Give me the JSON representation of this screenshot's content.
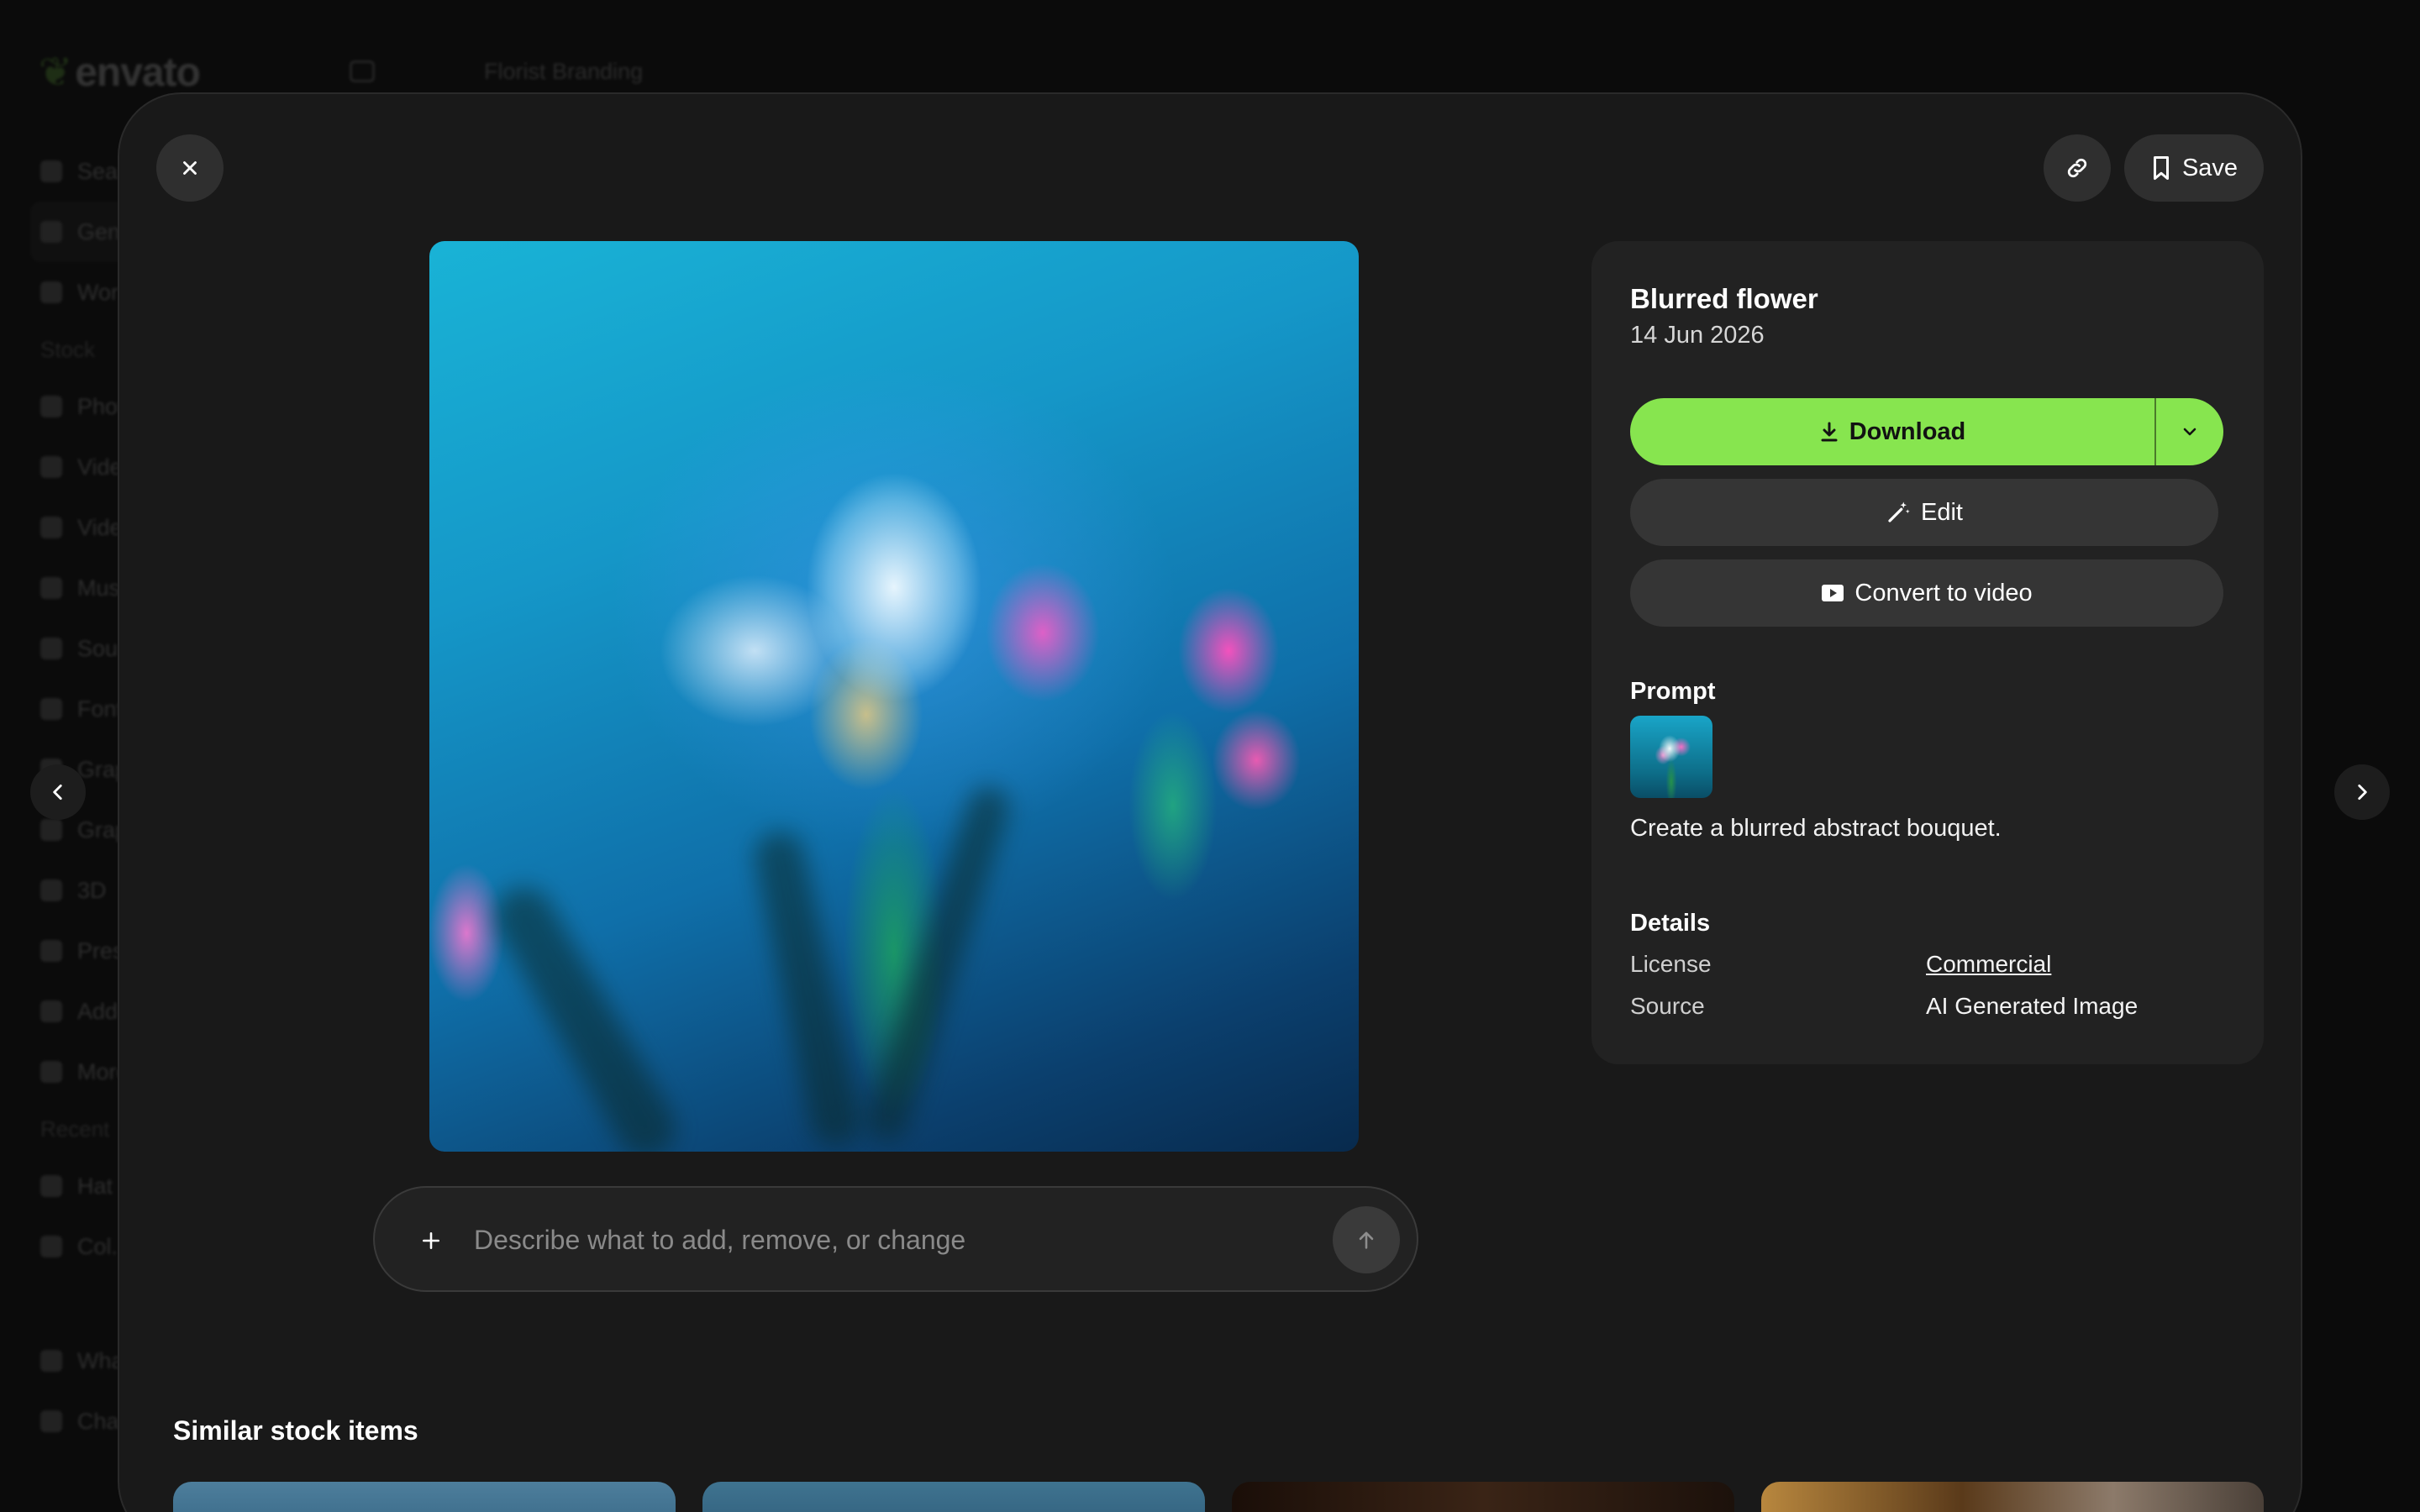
{
  "background_app": {
    "logo": "envato",
    "project_name": "Florist Branding",
    "sidebar_items": [
      "Search",
      "Generate",
      "Workspaces"
    ],
    "section_stock": "Stock",
    "stock_items": [
      "Photos",
      "Video",
      "Video templates",
      "Music",
      "Sound effects",
      "Fonts",
      "Graphics",
      "Graphic templates",
      "3D",
      "Presentation templates",
      "Add-ons",
      "More"
    ],
    "section_recent": "Recent",
    "recent_items": [
      "Hat",
      "Col..."
    ],
    "footer_items": [
      "What's new",
      "Changelog"
    ]
  },
  "modal": {
    "save_label": "Save",
    "icons": {
      "close": "close-icon",
      "link": "link-icon",
      "bookmark": "bookmark-icon",
      "prev": "chevron-left-icon",
      "next": "chevron-right-icon"
    },
    "image_alt": "Blurred flower",
    "prompt_bar": {
      "placeholder": "Describe what to add, remove, or change",
      "value": ""
    },
    "panel": {
      "title": "Blurred flower",
      "date": "14 Jun 2026",
      "download_label": "Download",
      "edit_label": "Edit",
      "convert_label": "Convert to video",
      "prompt_heading": "Prompt",
      "prompt_text": "Create a blurred abstract bouquet.",
      "details_heading": "Details",
      "details": [
        {
          "key": "License",
          "value": "Commercial"
        },
        {
          "key": "Source",
          "value": "AI Generated Image"
        }
      ]
    },
    "similar_heading": "Similar stock items"
  },
  "colors": {
    "accent_green": "#87e54f",
    "modal_bg": "#191919",
    "panel_bg": "#222222"
  }
}
